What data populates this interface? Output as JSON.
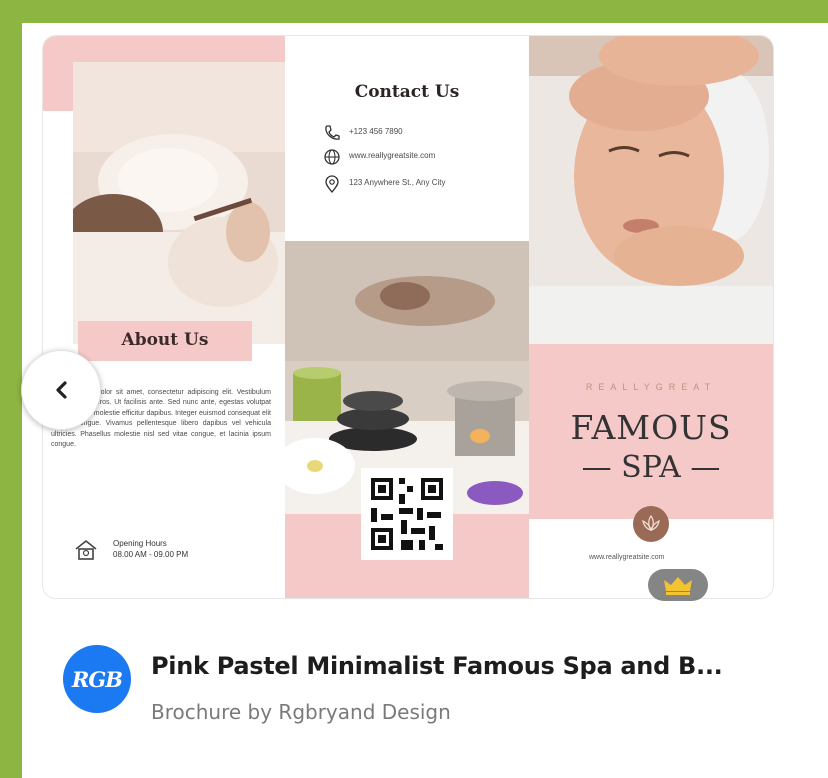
{
  "colors": {
    "frame": "#8db542",
    "pink": "#f6c9c9",
    "brand_blue": "#1b79f2",
    "accent_brown": "#9a6a56",
    "premium_gold": "#f2b705"
  },
  "brochure": {
    "about_title": "About Us",
    "about_body": "Lorem ipsum dolor sit amet, consectetur adipiscing elit. Vestibulum eget vehicula eros. Ut facilisis ante. Sed nunc ante, egestas volutpat commodo ut, molestie efficitur dapibus. Integer euismod consequat elit aliquet congue. Vivamus pellentesque libero dapibus vel vehicula ultricies. Phasellus molestie nisl sed vitae congue, et lacinia ipsum congue.",
    "hours_label": "Opening Hours",
    "hours_value": "08.00 AM - 09.00 PM",
    "contact_title": "Contact Us",
    "phone": "+123 456 7890",
    "website": "www.reallygreatsite.com",
    "address": "123 Anywhere St., Any City",
    "brand_small": "REALLYGREAT",
    "brand_big_1": "FAMOUS",
    "brand_big_2": "— SPA —",
    "footer_site": "www.reallygreatsite.com"
  },
  "icons": {
    "back": "chevron-left-icon",
    "premium": "crown-icon",
    "phone": "phone-icon",
    "web": "globe-icon",
    "location": "location-pin-icon",
    "home": "home-icon",
    "lotus": "lotus-icon"
  },
  "template": {
    "avatar_text": "RGB",
    "title": "Pink Pastel Minimalist Famous Spa and B...",
    "subtitle": "Brochure by Rgbryand Design"
  }
}
